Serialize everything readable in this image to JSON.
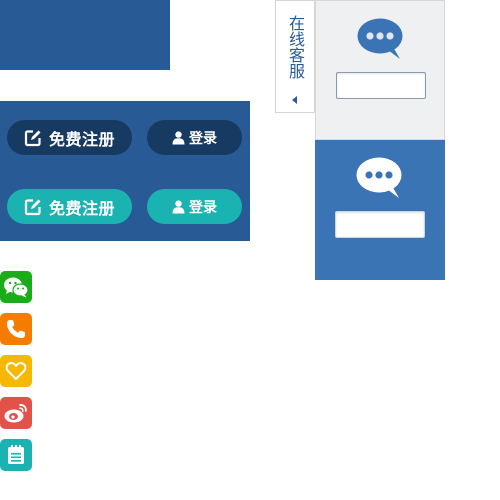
{
  "colors": {
    "panel_blue": "#285a96",
    "pill_dark": "#173a63",
    "pill_teal": "#1ab3b1",
    "chat_light": "#eff0f2",
    "chat_blue": "#3b74b5",
    "wechat": "#1aad19",
    "phone": "#f57c00",
    "favorite": "#f6b800",
    "weibo": "#e2524a",
    "notes": "#1ab3b1"
  },
  "login_panel": {
    "dark_row": {
      "register_label": "免费注册",
      "login_label": "登录"
    },
    "teal_row": {
      "register_label": "免费注册",
      "login_label": "登录"
    }
  },
  "social_icons": [
    "wechat-icon",
    "phone-icon",
    "heart-icon",
    "weibo-icon",
    "notepad-icon"
  ],
  "online_service": {
    "tab_label": "在线客服",
    "panels": [
      {
        "style": "light",
        "icon": "chat-bubble-icon",
        "input_value": ""
      },
      {
        "style": "blue",
        "icon": "chat-bubble-icon",
        "input_value": ""
      }
    ]
  }
}
